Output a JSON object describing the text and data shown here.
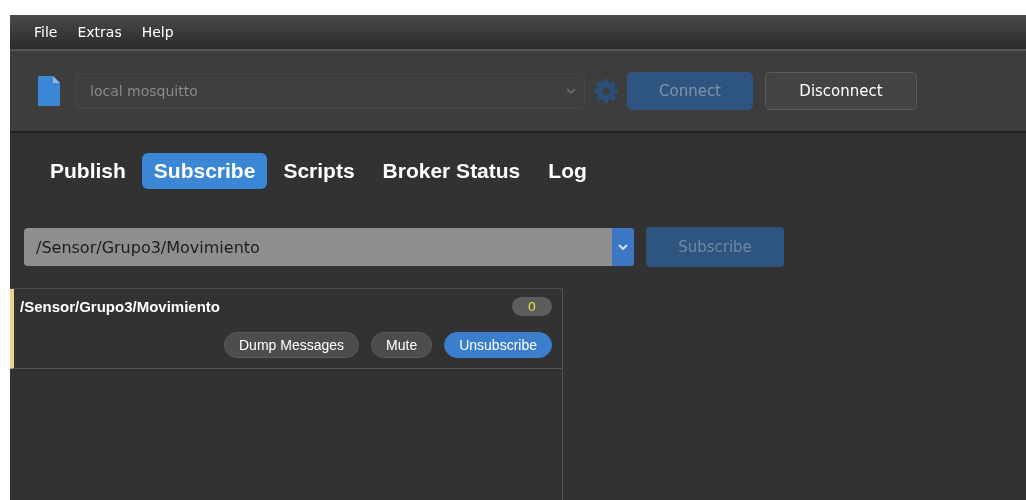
{
  "menu": [
    {
      "label": "File"
    },
    {
      "label": "Extras"
    },
    {
      "label": "Help"
    }
  ],
  "toolbar": {
    "profile": {
      "value": "local mosquitto",
      "disabled": true
    },
    "connect_button": {
      "label": "Connect",
      "disabled": true
    },
    "disconnect_button": {
      "label": "Disconnect",
      "disabled": false
    }
  },
  "tabs": [
    {
      "label": "Publish",
      "selected": false
    },
    {
      "label": "Subscribe",
      "selected": true
    },
    {
      "label": "Scripts",
      "selected": false
    },
    {
      "label": "Broker Status",
      "selected": false
    },
    {
      "label": "Log",
      "selected": false
    }
  ],
  "topic_field": {
    "value": "/Sensor/Grupo3/Movimiento"
  },
  "subscribe_button": {
    "label": "Subscribe",
    "disabled": true
  },
  "subscriptions": [
    {
      "topic": "/Sensor/Grupo3/Movimiento",
      "count": "0",
      "buttons": [
        {
          "label": "Dump Messages",
          "kind": "plain"
        },
        {
          "label": "Mute",
          "kind": "plain"
        },
        {
          "label": "Unsubscribe",
          "kind": "primary"
        }
      ]
    }
  ]
}
